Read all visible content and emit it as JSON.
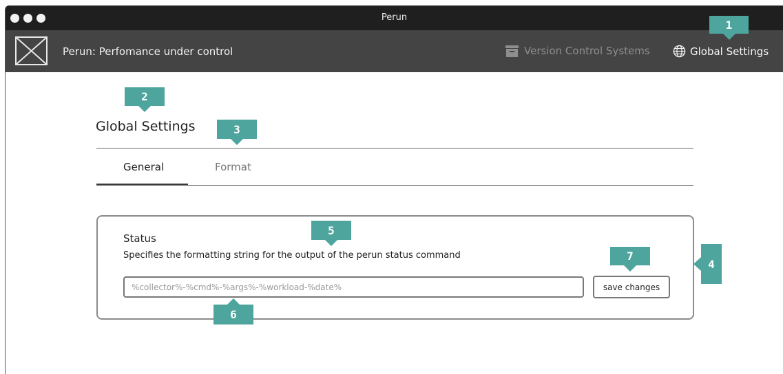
{
  "window": {
    "title": "Perun"
  },
  "header": {
    "app_title": "Perun: Perfomance under control",
    "nav": [
      {
        "label": "Version Control Systems",
        "icon": "archive-icon",
        "active": false
      },
      {
        "label": "Global Settings",
        "icon": "globe-icon",
        "active": true
      }
    ]
  },
  "main": {
    "page_title": "Global Settings",
    "tabs": [
      {
        "label": "General",
        "active": true
      },
      {
        "label": "Format",
        "active": false
      }
    ],
    "status_card": {
      "title": "Status",
      "description": "Specifies the formatting string for the output of the perun status command",
      "input_value": "",
      "input_placeholder": "%collector%-%cmd%-%args%-%workload-%date%",
      "save_label": "save changes"
    }
  },
  "callouts": [
    "1",
    "2",
    "3",
    "4",
    "5",
    "6",
    "7"
  ],
  "colors": {
    "titlebar": "#1f1f1f",
    "appbar": "#444444",
    "callout": "#4ea59e"
  }
}
